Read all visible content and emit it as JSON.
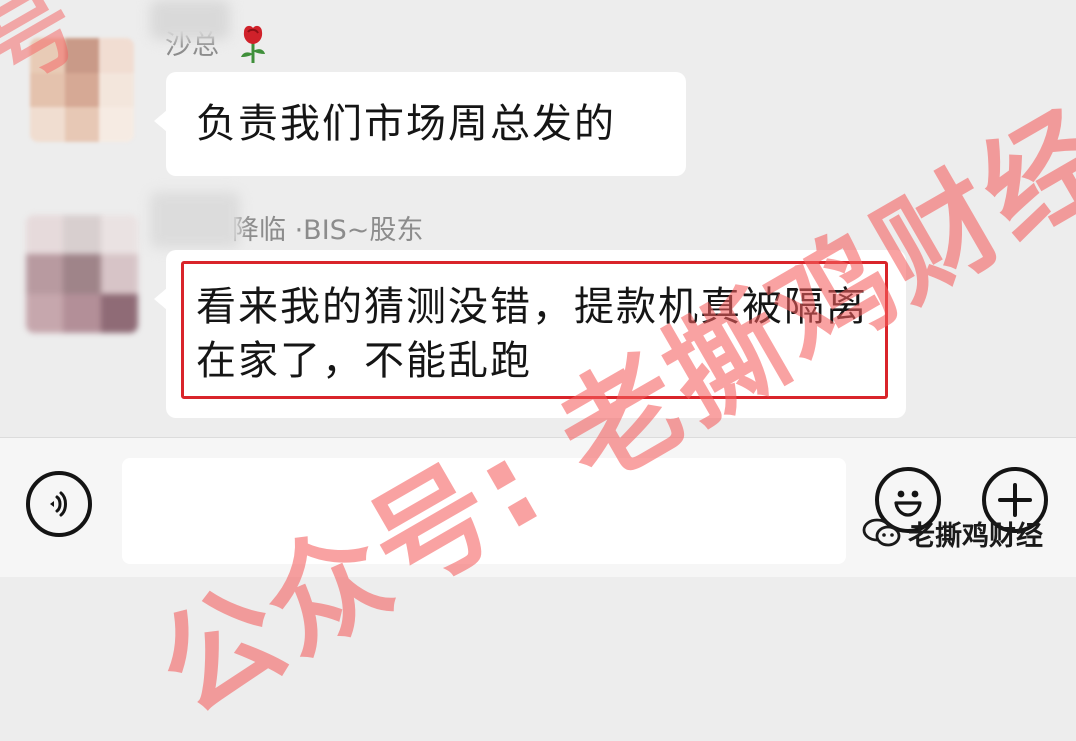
{
  "messages": [
    {
      "sender": "沙总",
      "sender_suffix_icon": "rose-icon",
      "text": "负责我们市场周总发的"
    },
    {
      "sender": "降临 ·BIS~股东",
      "text": "看来我的猜测没错，提款机真被隔离在家了，不能乱跑",
      "highlighted": true,
      "highlight_color": "#d9242a"
    }
  ],
  "input_bar": {
    "voice_icon": "voice-icon",
    "emoji_icon": "emoji-icon",
    "plus_icon": "plus-icon",
    "input_value": ""
  },
  "watermark": {
    "text": "公众号: 老撕鸡财经",
    "color": "#f55f5f"
  },
  "brand_badge": {
    "icon": "wechat-official-account-icon",
    "text": "老撕鸡财经"
  }
}
